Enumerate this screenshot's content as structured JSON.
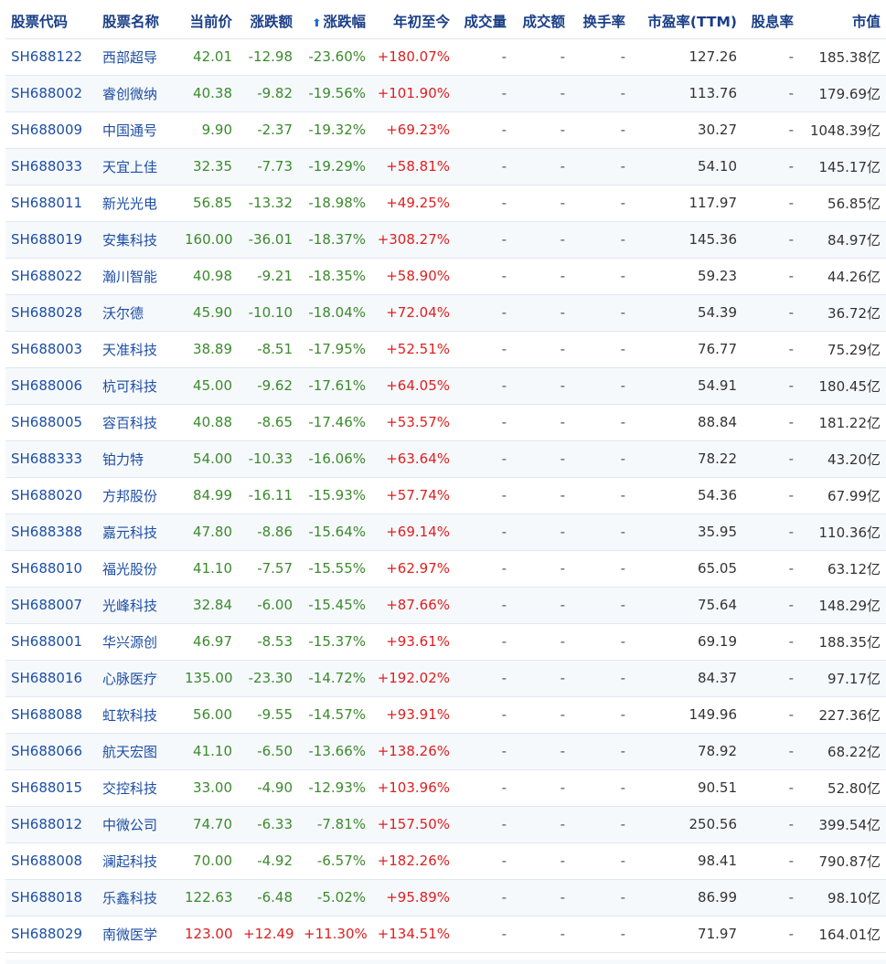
{
  "colors": {
    "header_text": "#1a3e86",
    "link": "#1d4ea3",
    "up": "#dd2020",
    "down": "#3b8a2d",
    "row_alt": "#f6f9fc",
    "border": "#dfe7f1"
  },
  "header": {
    "code": "股票代码",
    "name": "股票名称",
    "price": "当前价",
    "change": "涨跌额",
    "sort_icon": "up-arrow",
    "sort_arrow_glyph": "⬆",
    "change_pct": "涨跌幅",
    "ytd": "年初至今",
    "volume": "成交量",
    "turnover": "成交额",
    "turnover_rate": "换手率",
    "pe": "市盈率(TTM)",
    "dividend": "股息率",
    "market_cap": "市值"
  },
  "rows": [
    {
      "code": "SH688122",
      "name": "西部超导",
      "price": "42.01",
      "change": "-12.98",
      "change_pct": "-23.60%",
      "ytd": "+180.07%",
      "volume": "-",
      "turnover": "-",
      "turnover_rate": "-",
      "pe": "127.26",
      "dividend": "-",
      "market_cap": "185.38亿",
      "dir": "neg"
    },
    {
      "code": "SH688002",
      "name": "睿创微纳",
      "price": "40.38",
      "change": "-9.82",
      "change_pct": "-19.56%",
      "ytd": "+101.90%",
      "volume": "-",
      "turnover": "-",
      "turnover_rate": "-",
      "pe": "113.76",
      "dividend": "-",
      "market_cap": "179.69亿",
      "dir": "neg"
    },
    {
      "code": "SH688009",
      "name": "中国通号",
      "price": "9.90",
      "change": "-2.37",
      "change_pct": "-19.32%",
      "ytd": "+69.23%",
      "volume": "-",
      "turnover": "-",
      "turnover_rate": "-",
      "pe": "30.27",
      "dividend": "-",
      "market_cap": "1048.39亿",
      "dir": "neg"
    },
    {
      "code": "SH688033",
      "name": "天宜上佳",
      "price": "32.35",
      "change": "-7.73",
      "change_pct": "-19.29%",
      "ytd": "+58.81%",
      "volume": "-",
      "turnover": "-",
      "turnover_rate": "-",
      "pe": "54.10",
      "dividend": "-",
      "market_cap": "145.17亿",
      "dir": "neg"
    },
    {
      "code": "SH688011",
      "name": "新光光电",
      "price": "56.85",
      "change": "-13.32",
      "change_pct": "-18.98%",
      "ytd": "+49.25%",
      "volume": "-",
      "turnover": "-",
      "turnover_rate": "-",
      "pe": "117.97",
      "dividend": "-",
      "market_cap": "56.85亿",
      "dir": "neg"
    },
    {
      "code": "SH688019",
      "name": "安集科技",
      "price": "160.00",
      "change": "-36.01",
      "change_pct": "-18.37%",
      "ytd": "+308.27%",
      "volume": "-",
      "turnover": "-",
      "turnover_rate": "-",
      "pe": "145.36",
      "dividend": "-",
      "market_cap": "84.97亿",
      "dir": "neg"
    },
    {
      "code": "SH688022",
      "name": "瀚川智能",
      "price": "40.98",
      "change": "-9.21",
      "change_pct": "-18.35%",
      "ytd": "+58.90%",
      "volume": "-",
      "turnover": "-",
      "turnover_rate": "-",
      "pe": "59.23",
      "dividend": "-",
      "market_cap": "44.26亿",
      "dir": "neg"
    },
    {
      "code": "SH688028",
      "name": "沃尔德",
      "price": "45.90",
      "change": "-10.10",
      "change_pct": "-18.04%",
      "ytd": "+72.04%",
      "volume": "-",
      "turnover": "-",
      "turnover_rate": "-",
      "pe": "54.39",
      "dividend": "-",
      "market_cap": "36.72亿",
      "dir": "neg"
    },
    {
      "code": "SH688003",
      "name": "天准科技",
      "price": "38.89",
      "change": "-8.51",
      "change_pct": "-17.95%",
      "ytd": "+52.51%",
      "volume": "-",
      "turnover": "-",
      "turnover_rate": "-",
      "pe": "76.77",
      "dividend": "-",
      "market_cap": "75.29亿",
      "dir": "neg"
    },
    {
      "code": "SH688006",
      "name": "杭可科技",
      "price": "45.00",
      "change": "-9.62",
      "change_pct": "-17.61%",
      "ytd": "+64.05%",
      "volume": "-",
      "turnover": "-",
      "turnover_rate": "-",
      "pe": "54.91",
      "dividend": "-",
      "market_cap": "180.45亿",
      "dir": "neg"
    },
    {
      "code": "SH688005",
      "name": "容百科技",
      "price": "40.88",
      "change": "-8.65",
      "change_pct": "-17.46%",
      "ytd": "+53.57%",
      "volume": "-",
      "turnover": "-",
      "turnover_rate": "-",
      "pe": "88.84",
      "dividend": "-",
      "market_cap": "181.22亿",
      "dir": "neg"
    },
    {
      "code": "SH688333",
      "name": "铂力特",
      "price": "54.00",
      "change": "-10.33",
      "change_pct": "-16.06%",
      "ytd": "+63.64%",
      "volume": "-",
      "turnover": "-",
      "turnover_rate": "-",
      "pe": "78.22",
      "dividend": "-",
      "market_cap": "43.20亿",
      "dir": "neg"
    },
    {
      "code": "SH688020",
      "name": "方邦股份",
      "price": "84.99",
      "change": "-16.11",
      "change_pct": "-15.93%",
      "ytd": "+57.74%",
      "volume": "-",
      "turnover": "-",
      "turnover_rate": "-",
      "pe": "54.36",
      "dividend": "-",
      "market_cap": "67.99亿",
      "dir": "neg"
    },
    {
      "code": "SH688388",
      "name": "嘉元科技",
      "price": "47.80",
      "change": "-8.86",
      "change_pct": "-15.64%",
      "ytd": "+69.14%",
      "volume": "-",
      "turnover": "-",
      "turnover_rate": "-",
      "pe": "35.95",
      "dividend": "-",
      "market_cap": "110.36亿",
      "dir": "neg"
    },
    {
      "code": "SH688010",
      "name": "福光股份",
      "price": "41.10",
      "change": "-7.57",
      "change_pct": "-15.55%",
      "ytd": "+62.97%",
      "volume": "-",
      "turnover": "-",
      "turnover_rate": "-",
      "pe": "65.05",
      "dividend": "-",
      "market_cap": "63.12亿",
      "dir": "neg"
    },
    {
      "code": "SH688007",
      "name": "光峰科技",
      "price": "32.84",
      "change": "-6.00",
      "change_pct": "-15.45%",
      "ytd": "+87.66%",
      "volume": "-",
      "turnover": "-",
      "turnover_rate": "-",
      "pe": "75.64",
      "dividend": "-",
      "market_cap": "148.29亿",
      "dir": "neg"
    },
    {
      "code": "SH688001",
      "name": "华兴源创",
      "price": "46.97",
      "change": "-8.53",
      "change_pct": "-15.37%",
      "ytd": "+93.61%",
      "volume": "-",
      "turnover": "-",
      "turnover_rate": "-",
      "pe": "69.19",
      "dividend": "-",
      "market_cap": "188.35亿",
      "dir": "neg"
    },
    {
      "code": "SH688016",
      "name": "心脉医疗",
      "price": "135.00",
      "change": "-23.30",
      "change_pct": "-14.72%",
      "ytd": "+192.02%",
      "volume": "-",
      "turnover": "-",
      "turnover_rate": "-",
      "pe": "84.37",
      "dividend": "-",
      "market_cap": "97.17亿",
      "dir": "neg"
    },
    {
      "code": "SH688088",
      "name": "虹软科技",
      "price": "56.00",
      "change": "-9.55",
      "change_pct": "-14.57%",
      "ytd": "+93.91%",
      "volume": "-",
      "turnover": "-",
      "turnover_rate": "-",
      "pe": "149.96",
      "dividend": "-",
      "market_cap": "227.36亿",
      "dir": "neg"
    },
    {
      "code": "SH688066",
      "name": "航天宏图",
      "price": "41.10",
      "change": "-6.50",
      "change_pct": "-13.66%",
      "ytd": "+138.26%",
      "volume": "-",
      "turnover": "-",
      "turnover_rate": "-",
      "pe": "78.92",
      "dividend": "-",
      "market_cap": "68.22亿",
      "dir": "neg"
    },
    {
      "code": "SH688015",
      "name": "交控科技",
      "price": "33.00",
      "change": "-4.90",
      "change_pct": "-12.93%",
      "ytd": "+103.96%",
      "volume": "-",
      "turnover": "-",
      "turnover_rate": "-",
      "pe": "90.51",
      "dividend": "-",
      "market_cap": "52.80亿",
      "dir": "neg"
    },
    {
      "code": "SH688012",
      "name": "中微公司",
      "price": "74.70",
      "change": "-6.33",
      "change_pct": "-7.81%",
      "ytd": "+157.50%",
      "volume": "-",
      "turnover": "-",
      "turnover_rate": "-",
      "pe": "250.56",
      "dividend": "-",
      "market_cap": "399.54亿",
      "dir": "neg"
    },
    {
      "code": "SH688008",
      "name": "澜起科技",
      "price": "70.00",
      "change": "-4.92",
      "change_pct": "-6.57%",
      "ytd": "+182.26%",
      "volume": "-",
      "turnover": "-",
      "turnover_rate": "-",
      "pe": "98.41",
      "dividend": "-",
      "market_cap": "790.87亿",
      "dir": "neg"
    },
    {
      "code": "SH688018",
      "name": "乐鑫科技",
      "price": "122.63",
      "change": "-6.48",
      "change_pct": "-5.02%",
      "ytd": "+95.89%",
      "volume": "-",
      "turnover": "-",
      "turnover_rate": "-",
      "pe": "86.99",
      "dividend": "-",
      "market_cap": "98.10亿",
      "dir": "neg"
    },
    {
      "code": "SH688029",
      "name": "南微医学",
      "price": "123.00",
      "change": "+12.49",
      "change_pct": "+11.30%",
      "ytd": "+134.51%",
      "volume": "-",
      "turnover": "-",
      "turnover_rate": "-",
      "pe": "71.97",
      "dividend": "-",
      "market_cap": "164.01亿",
      "dir": "pos"
    }
  ]
}
